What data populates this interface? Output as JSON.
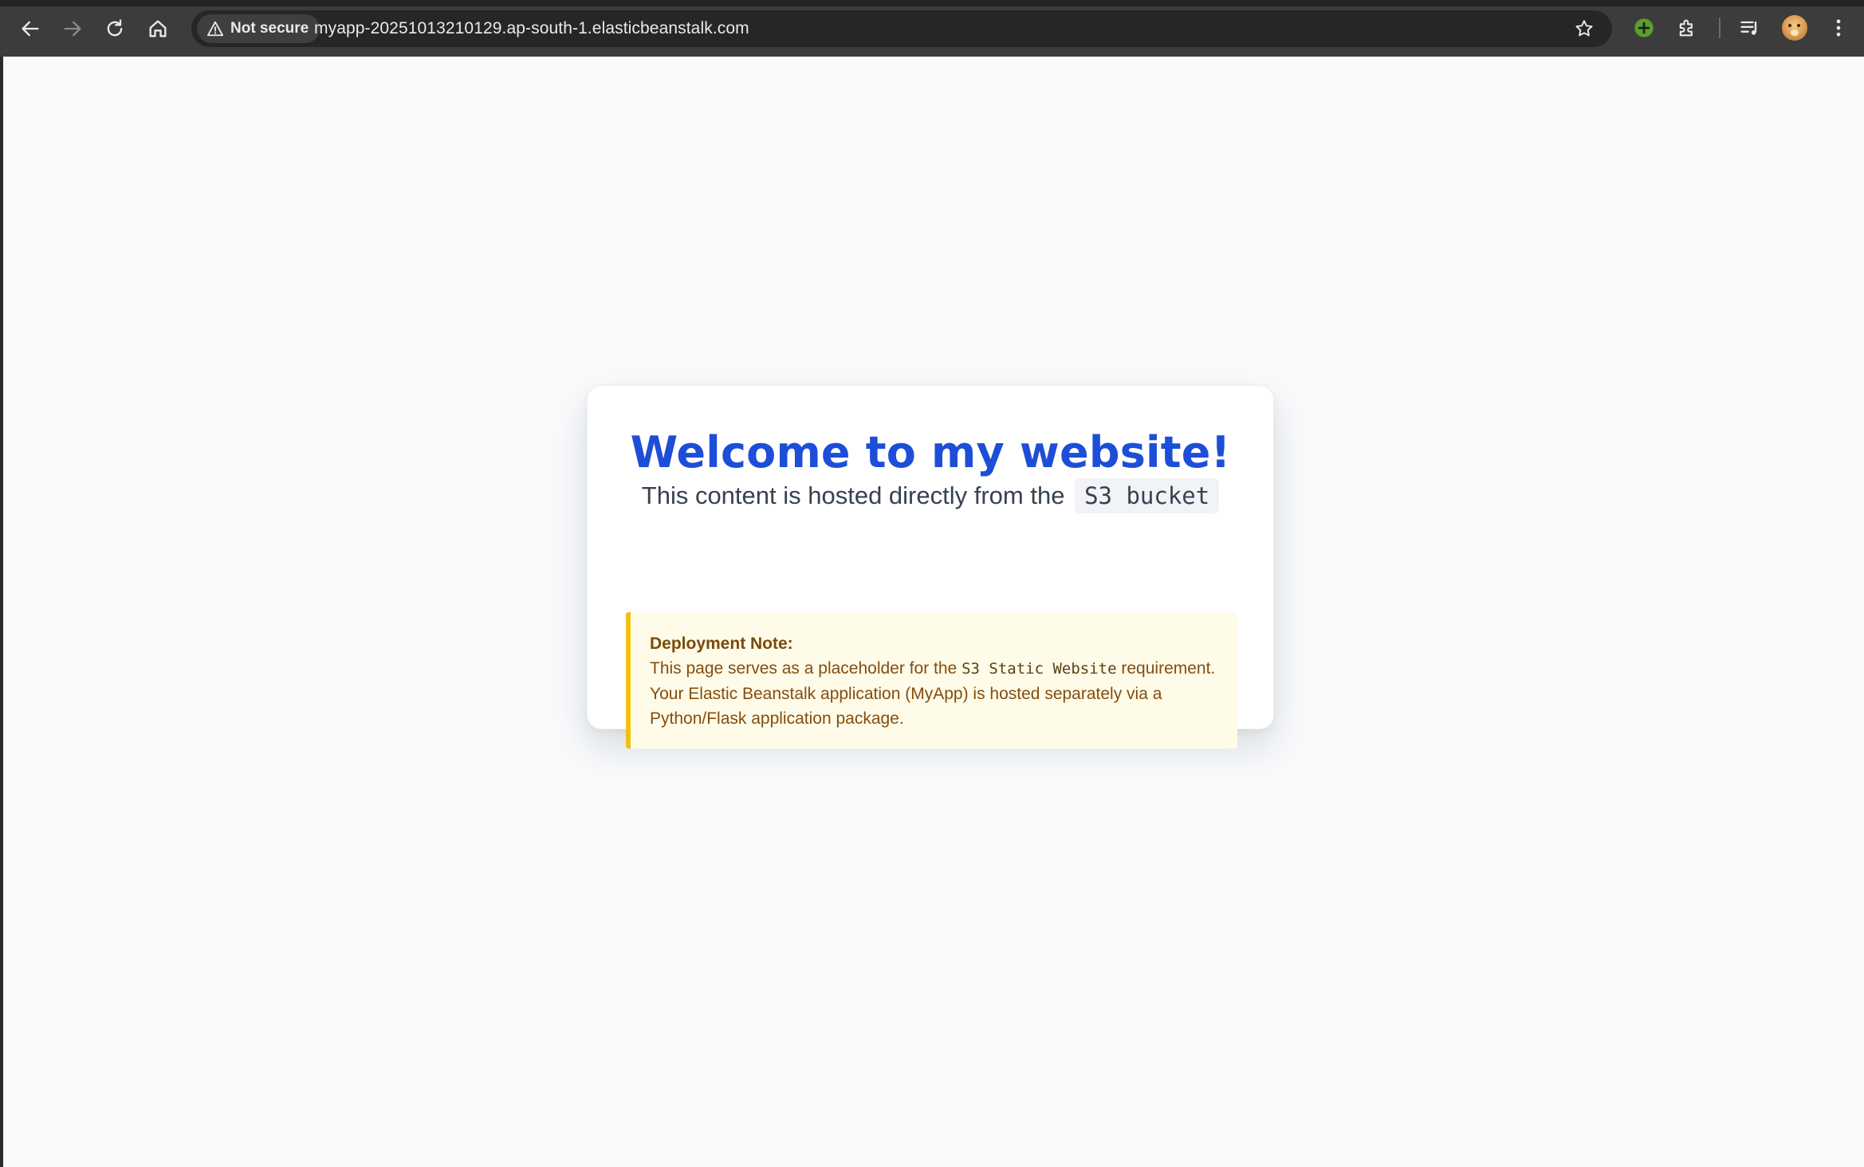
{
  "browser": {
    "security_label": "Not secure",
    "url": "myapp-20251013210129.ap-south-1.elasticbeanstalk.com",
    "icons": [
      "back-arrow-icon",
      "forward-arrow-icon",
      "reload-icon",
      "home-icon",
      "warning-triangle-icon",
      "star-icon",
      "extension-plus-icon",
      "puzzle-icon",
      "media-queue-icon",
      "profile-avatar",
      "kebab-menu-icon"
    ]
  },
  "page": {
    "title": "Welcome to my website!",
    "subtitle_prefix": "This content is hosted directly from the",
    "subtitle_code": "S3 bucket",
    "note": {
      "heading": "Deployment Note:",
      "line1_prefix": "This page serves as a placeholder for the",
      "line1_code": "S3 Static Website",
      "line1_suffix": "requirement.",
      "line2": "Your Elastic Beanstalk application (MyApp) is hosted separately via a",
      "line3": "Python/Flask application package."
    }
  },
  "colors": {
    "title": "#1d4ed8",
    "note_border": "#f2c010",
    "note_background": "#fefbe8",
    "note_text": "#854d0e",
    "page_background": "#f8fafc"
  }
}
